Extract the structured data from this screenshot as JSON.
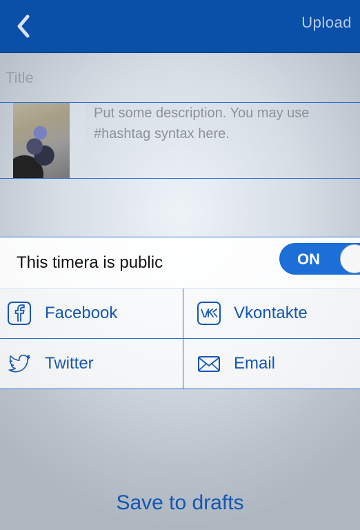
{
  "header": {
    "back_icon": "chevron-left-icon",
    "upload_label": "Upload",
    "background_color": "#0a4fa8"
  },
  "form": {
    "title_placeholder": "Title",
    "title_value": "",
    "description_placeholder": "Put some description. You may use #hashtag syntax here."
  },
  "privacy": {
    "label": "This timera is public",
    "toggle_label": "ON",
    "toggle_on": true
  },
  "share": {
    "items": [
      {
        "label": "Facebook",
        "icon": "facebook-icon"
      },
      {
        "label": "Vkontakte",
        "icon": "vkontakte-icon"
      },
      {
        "label": "Twitter",
        "icon": "twitter-icon"
      },
      {
        "label": "Email",
        "icon": "email-icon"
      }
    ]
  },
  "footer": {
    "save_drafts_label": "Save to drafts"
  },
  "colors": {
    "accent": "#1456b4",
    "divider": "#2f6ed0",
    "toggle_on": "#1b6fd6"
  }
}
